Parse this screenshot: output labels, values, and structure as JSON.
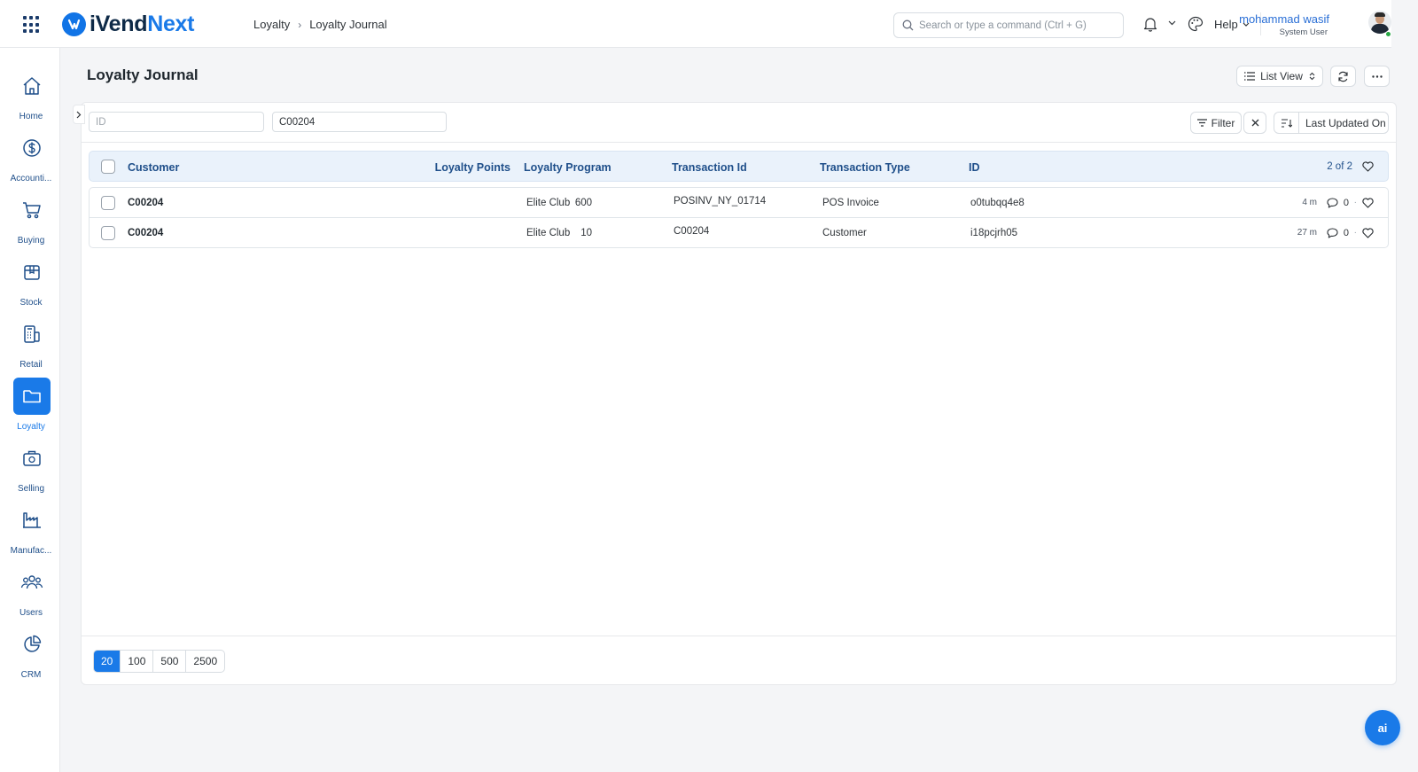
{
  "app": {
    "brand_primary": "iVend",
    "brand_accent": "Next",
    "accent_color": "#1a7ae8"
  },
  "breadcrumb": {
    "items": [
      "Loyalty",
      "Loyalty Journal"
    ]
  },
  "search": {
    "placeholder": "Search or type a command (Ctrl + G)"
  },
  "header": {
    "help_label": "Help",
    "user_name": "mohammad wasif",
    "user_role": "System User"
  },
  "sidebar": {
    "items": [
      {
        "label": "Home",
        "icon": "home-icon"
      },
      {
        "label": "Accounti...",
        "icon": "dollar-icon"
      },
      {
        "label": "Buying",
        "icon": "cart-icon"
      },
      {
        "label": "Stock",
        "icon": "box-icon"
      },
      {
        "label": "Retail",
        "icon": "pos-icon"
      },
      {
        "label": "Loyalty",
        "icon": "folder-icon",
        "active": true
      },
      {
        "label": "Selling",
        "icon": "bag-icon"
      },
      {
        "label": "Manufac...",
        "icon": "factory-icon"
      },
      {
        "label": "Users",
        "icon": "users-icon"
      },
      {
        "label": "CRM",
        "icon": "pie-icon"
      }
    ]
  },
  "page": {
    "title": "Loyalty Journal",
    "view_label": "List View"
  },
  "filters": {
    "id_placeholder": "ID",
    "customer_value": "C00204",
    "filter_label": "Filter",
    "sort_label": "Last Updated On"
  },
  "list": {
    "columns": [
      "Customer",
      "Loyalty Points",
      "Loyalty Program",
      "Transaction Id",
      "Transaction Type",
      "ID"
    ],
    "count_label": "2 of 2",
    "rows": [
      {
        "customer": "C00204",
        "points": "600",
        "program": "Elite Club",
        "transaction_id": "POSINV_NY_01714",
        "transaction_type": "POS Invoice",
        "id": "o0tubqq4e8",
        "modified": "4 m",
        "comments": "0"
      },
      {
        "customer": "C00204",
        "points": "10",
        "program": "Elite Club",
        "transaction_id": "C00204",
        "transaction_type": "Customer",
        "id": "i18pcjrh05",
        "modified": "27 m",
        "comments": "0"
      }
    ]
  },
  "pagination": {
    "sizes": [
      "20",
      "100",
      "500",
      "2500"
    ],
    "active": "20"
  },
  "fab": {
    "label": "ai"
  }
}
